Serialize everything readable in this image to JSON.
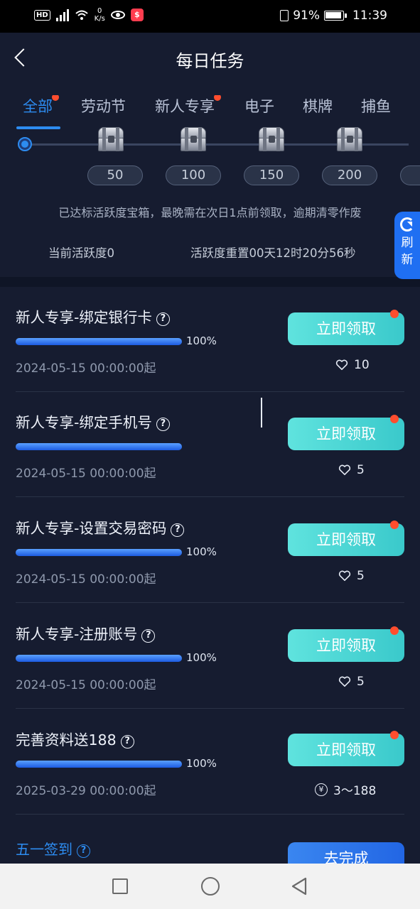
{
  "status": {
    "hd": "HD",
    "net_speed": "0",
    "net_unit": "K/s",
    "battery": "91%",
    "time": "11:39"
  },
  "header": {
    "title": "每日任务"
  },
  "tabs": [
    {
      "label": "全部",
      "active": true,
      "dot": true
    },
    {
      "label": "劳动节",
      "active": false,
      "dot": false
    },
    {
      "label": "新人专享",
      "active": false,
      "dot": true
    },
    {
      "label": "电子",
      "active": false,
      "dot": false
    },
    {
      "label": "棋牌",
      "active": false,
      "dot": false
    },
    {
      "label": "捕鱼",
      "active": false,
      "dot": false
    }
  ],
  "milestones": [
    "50",
    "100",
    "150",
    "200"
  ],
  "notice": "已达标活跃度宝箱，最晚需在次日1点前领取，逾期清零作废",
  "activity": "当前活跃度0",
  "reset": "活跃度重置00天12时20分56秒",
  "refresh": {
    "line1": "刷",
    "line2": "新"
  },
  "tasks": [
    {
      "title": "新人专享-绑定银行卡",
      "progress": 1.0,
      "percent": "100%",
      "date": "2024-05-15 00:00:00起",
      "button": "立即领取",
      "reward": "10",
      "reward_icon": "heart-icon"
    },
    {
      "title": "新人专享-绑定手机号",
      "progress": 1.0,
      "percent": "",
      "date": "2024-05-15 00:00:00起",
      "button": "立即领取",
      "reward": "5",
      "reward_icon": "heart-icon"
    },
    {
      "title": "新人专享-设置交易密码",
      "progress": 1.0,
      "percent": "100%",
      "date": "2024-05-15 00:00:00起",
      "button": "立即领取",
      "reward": "5",
      "reward_icon": "heart-icon"
    },
    {
      "title": "新人专享-注册账号",
      "progress": 1.0,
      "percent": "100%",
      "date": "2024-05-15 00:00:00起",
      "button": "立即领取",
      "reward": "5",
      "reward_icon": "heart-icon"
    },
    {
      "title": "完善资料送188",
      "progress": 1.0,
      "percent": "100%",
      "date": "2025-03-29 00:00:00起",
      "button": "立即领取",
      "reward": "3～188",
      "reward_icon": "yen-icon"
    }
  ],
  "signin": {
    "title": "五一签到",
    "button": "去完成"
  },
  "qmark": "?",
  "yen_symbol": "¥",
  "colors": {
    "accent": "#2d8cf0",
    "claim": "#4fd8d6",
    "dot": "#ff4d2e",
    "bg": "#161c30"
  }
}
